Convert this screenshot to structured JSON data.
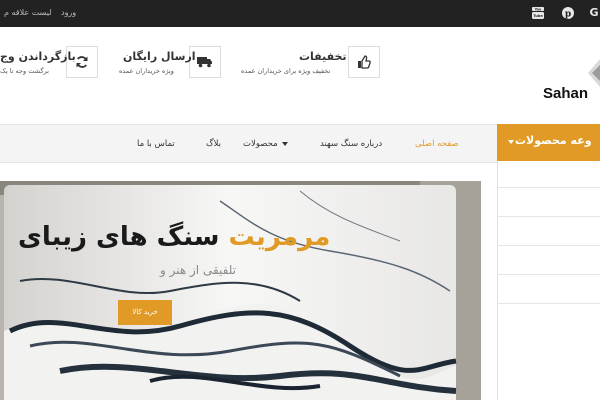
{
  "topbar": {
    "wishlist_label": "لیست علاقه م",
    "login_label": "ورود",
    "social_icons": [
      "google-icon",
      "pinterest-icon",
      "youtube-icon"
    ]
  },
  "header": {
    "brand_text": "Sahan",
    "features": [
      {
        "title": "تخفیفات",
        "subtitle": "تخفیف ویژه برای خریداران عمده",
        "icon": "thumbs-up-icon"
      },
      {
        "title": "ارسال رایگان",
        "subtitle": "ویژه خریداران عمده",
        "icon": "truck-icon"
      },
      {
        "title": "بازگرداندن وج",
        "subtitle": "برگشت وجه تا یک",
        "icon": "refresh-icon"
      }
    ]
  },
  "nav": {
    "items": [
      {
        "label": "صفحه اصلی",
        "active": true
      },
      {
        "label": "درباره سنگ سهند",
        "active": false
      },
      {
        "label": "محصولات",
        "active": false,
        "has_dropdown": true
      },
      {
        "label": "بلاگ",
        "active": false
      },
      {
        "label": "تماس با ما",
        "active": false
      }
    ],
    "category_button_label": "وعه محصولات"
  },
  "hero": {
    "title_main": "سنگ های زیبای",
    "title_accent": "مرمریت",
    "subtitle": "تلفیقی از هنر و",
    "button_label": "خرید کالا"
  },
  "colors": {
    "accent": "#e29a27",
    "topbar_bg": "#222222",
    "nav_bg": "#f4f4f4"
  }
}
